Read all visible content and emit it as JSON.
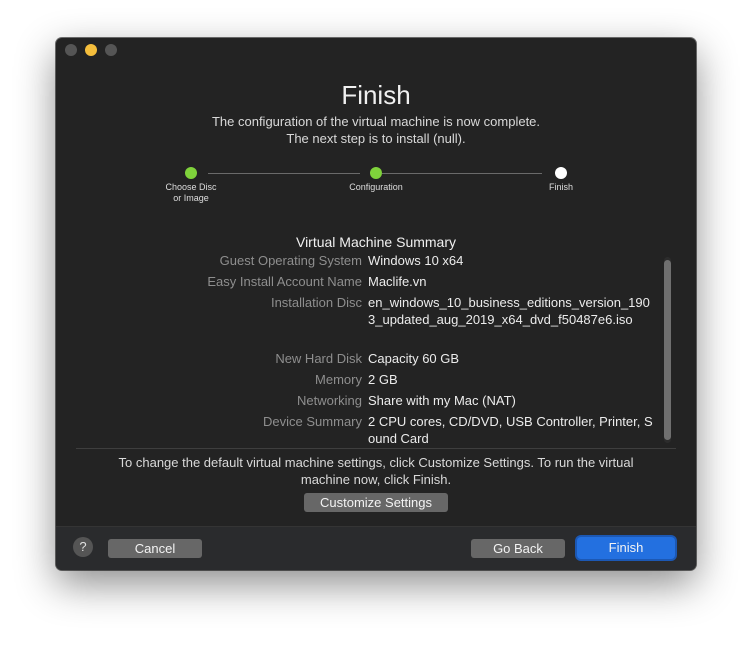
{
  "window": {
    "title": "Finish",
    "subtitle_line1": "The configuration of the virtual machine is now complete.",
    "subtitle_line2": "The next step is to install (null)."
  },
  "steps": [
    {
      "label_line1": "Choose Disc",
      "label_line2": "or Image",
      "state": "done"
    },
    {
      "label_line1": "Configuration",
      "label_line2": "",
      "state": "done"
    },
    {
      "label_line1": "Finish",
      "label_line2": "",
      "state": "current"
    }
  ],
  "summary": {
    "title": "Virtual Machine Summary",
    "rows": [
      {
        "key": "Guest Operating System",
        "value": "Windows 10 x64"
      },
      {
        "key": "Easy Install Account Name",
        "value": "Maclife.vn"
      },
      {
        "key": "Installation Disc",
        "value": "en_windows_10_business_editions_version_1903_updated_aug_2019_x64_dvd_f50487e6.iso"
      },
      {
        "key": "New Hard Disk",
        "value": "Capacity 60 GB"
      },
      {
        "key": "Memory",
        "value": "2 GB"
      },
      {
        "key": "Networking",
        "value": "Share with my Mac (NAT)"
      },
      {
        "key": "Device Summary",
        "value": "2 CPU cores, CD/DVD, USB Controller, Printer, Sound Card"
      }
    ]
  },
  "note": "To change the default virtual machine settings, click Customize Settings. To run the virtual machine now, click Finish.",
  "buttons": {
    "customize": "Customize Settings",
    "help": "?",
    "cancel": "Cancel",
    "go_back": "Go Back",
    "finish": "Finish"
  },
  "colors": {
    "window_bg": "#232323",
    "step_done": "#7fd23b",
    "step_current": "#ffffff",
    "primary_button": "#2370e0",
    "minimize_light": "#f5be3c"
  }
}
